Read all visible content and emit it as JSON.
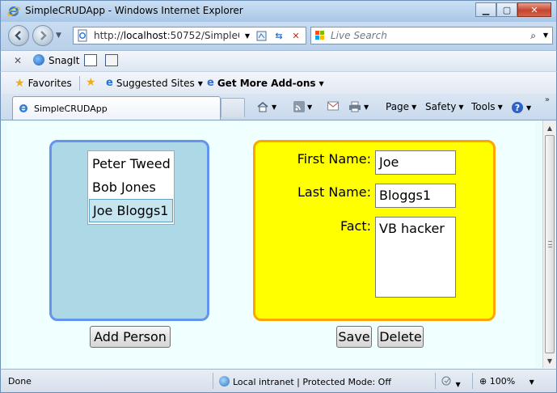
{
  "window": {
    "title": "SimpleCRUDApp - Windows Internet Explorer",
    "minimize": "▁",
    "maximize": "▢",
    "close": "✕"
  },
  "nav": {
    "url_prefix": "http://",
    "url_host": "localhost",
    "url_rest": ":50752/SimpleC",
    "search_placeholder": "Live Search"
  },
  "toolbar": {
    "snagit_label": "SnagIt"
  },
  "favorites_bar": {
    "favorites_label": "Favorites",
    "suggested_sites_label": "Suggested Sites",
    "get_addons_label": "Get More Add-ons"
  },
  "tabs": [
    {
      "label": "SimpleCRUDApp"
    }
  ],
  "commands": {
    "page_label": "Page",
    "safety_label": "Safety",
    "tools_label": "Tools"
  },
  "app": {
    "people": [
      {
        "name": "Peter Tweed"
      },
      {
        "name": "Bob Jones"
      },
      {
        "name": "Joe Bloggs1"
      }
    ],
    "selected_index": 2,
    "add_person_label": "Add Person",
    "form": {
      "first_name_label": "First Name:",
      "first_name_value": "Joe",
      "last_name_label": "Last Name:",
      "last_name_value": "Bloggs1",
      "fact_label": "Fact:",
      "fact_value": "VB hacker"
    },
    "save_label": "Save",
    "delete_label": "Delete"
  },
  "status": {
    "text": "Done",
    "zone": "Local intranet | Protected Mode: Off",
    "zoom": "100%"
  },
  "colors": {
    "left_panel_bg": "#add8e6",
    "left_panel_border": "#6495ed",
    "right_panel_bg": "#ffff00",
    "right_panel_border": "#ffa500",
    "page_bg": "#f0ffff"
  }
}
